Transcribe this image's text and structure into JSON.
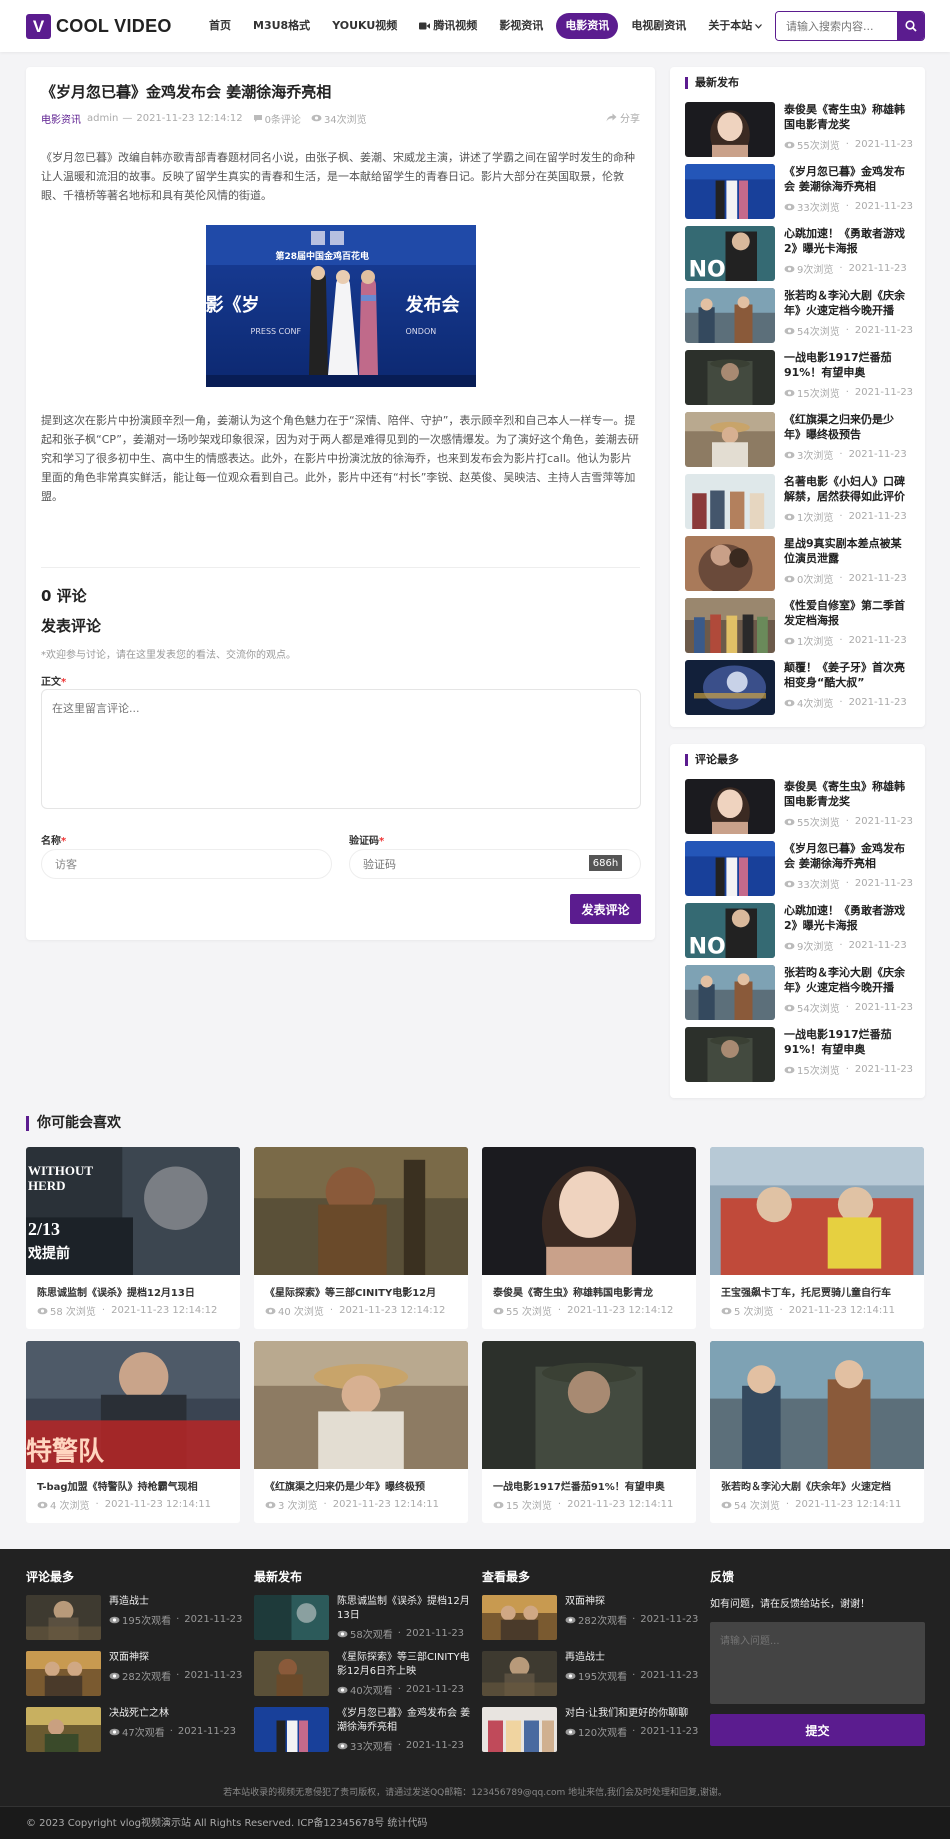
{
  "header": {
    "logo_letter": "V",
    "logo_text": "COOL VIDEO",
    "nav": [
      {
        "label": "首页",
        "active": false
      },
      {
        "label": "M3U8格式",
        "active": false
      },
      {
        "label": "YOUKU视频",
        "active": false
      },
      {
        "label": "腾讯视频",
        "active": false,
        "icon": "video-camera-icon"
      },
      {
        "label": "影视资讯",
        "active": false
      },
      {
        "label": "电影资讯",
        "active": true
      },
      {
        "label": "电视剧资讯",
        "active": false
      },
      {
        "label": "关于本站",
        "active": false,
        "dropdown": true
      }
    ],
    "search_placeholder": "请输入搜索内容..."
  },
  "article": {
    "title": "《岁月忽已暮》金鸡发布会 姜潮徐海乔亮相",
    "category": "电影资讯",
    "author": "admin",
    "dash": "—",
    "date": "2021-11-23 12:14:12",
    "comments": "0条评论",
    "views": "34次浏览",
    "share": "分享",
    "para1": "《岁月忽已暮》改编自韩亦歌青部青春题材同名小说，由张子枫、姜潮、宋威龙主演，讲述了学霸之间在留学时发生的命种让人温暖和流泪的故事。反映了留学生真实的青春和生活，是一本献给留学生的青春日记。影片大部分在英国取景，伦敦眼、千禧桥等著名地标和具有英伦风情的街道。",
    "para2": "提到这次在影片中扮演顾辛烈一角，姜潮认为这个角色魅力在于“深情、陪伴、守护”，表示顾辛烈和自己本人一样专一。提起和张子枫“CP”，姜潮对一场吵架戏印象很深，因为对于两人都是难得见到的一次感情爆发。为了演好这个角色，姜潮去研究和学习了很多初中生、高中生的情感表达。此外，在影片中扮演沈放的徐海乔，也来到发布会为影片打call。他认为影片里面的角色非常真实鲜活，能让每一位观众看到自己。此外，影片中还有“村长”李锐、赵英俊、吴映洁、主持人吉雪萍等加盟。",
    "image_text_big": "影《岁",
    "image_text_right": "发布会",
    "image_text_top": "第28届中国金鸡百花电",
    "image_text_press": "PRESS CONF",
    "image_text_london": "ONDON"
  },
  "comments": {
    "count_title": "0 评论",
    "form_title": "发表评论",
    "note": "*欢迎参与讨论，请在这里发表您的看法、交流你的观点。",
    "body_label": "正文",
    "body_placeholder": "在这里留言评论...",
    "name_label": "名称",
    "name_value": "访客",
    "captcha_label": "验证码",
    "captcha_placeholder": "验证码",
    "captcha_code": "686h",
    "submit_label": "发表评论",
    "required_mark": "*"
  },
  "sidebar_latest": {
    "title": "最新发布",
    "items": [
      {
        "title": "泰俊昊《寄生虫》称雄韩国电影青龙奖",
        "views": "55次浏览",
        "date": "2021-11-23",
        "thumb": "t-actress"
      },
      {
        "title": "《岁月忽已暮》金鸡发布会 姜潮徐海乔亮相",
        "views": "33次浏览",
        "date": "2021-11-23",
        "thumb": "t-press"
      },
      {
        "title": "心跳加速！《勇敢者游戏2》曝光卡海报",
        "views": "9次浏览",
        "date": "2021-11-23",
        "thumb": "t-bond"
      },
      {
        "title": "张若昀＆李沁大剧《庆余年》火速定档今晚开播",
        "views": "54次浏览",
        "date": "2021-11-23",
        "thumb": "t-drama"
      },
      {
        "title": "一战电影1917烂番茄91%！有望申奥",
        "views": "15次浏览",
        "date": "2021-11-23",
        "thumb": "t-war"
      },
      {
        "title": "《红旗渠之归来仍是少年》曝终极预告",
        "views": "3次浏览",
        "date": "2021-11-23",
        "thumb": "t-village"
      },
      {
        "title": "名著电影《小妇人》口碑解禁，居然获得如此评价",
        "views": "1次浏览",
        "date": "2021-11-23",
        "thumb": "t-women"
      },
      {
        "title": "星战9真实剧本差点被某位演员泄露",
        "views": "0次浏览",
        "date": "2021-11-23",
        "thumb": "t-hug"
      },
      {
        "title": "《性爱自修室》第二季首发定档海报",
        "views": "1次浏览",
        "date": "2021-11-23",
        "thumb": "t-group"
      },
      {
        "title": "颠覆！《姜子牙》首次亮相变身“酷大叔”",
        "views": "4次浏览",
        "date": "2021-11-23",
        "thumb": "t-anim"
      }
    ]
  },
  "sidebar_top": {
    "title": "评论最多",
    "items": [
      {
        "title": "泰俊昊《寄生虫》称雄韩国电影青龙奖",
        "views": "55次浏览",
        "date": "2021-11-23",
        "thumb": "t-actress"
      },
      {
        "title": "《岁月忽已暮》金鸡发布会 姜潮徐海乔亮相",
        "views": "33次浏览",
        "date": "2021-11-23",
        "thumb": "t-press"
      },
      {
        "title": "心跳加速！《勇敢者游戏2》曝光卡海报",
        "views": "9次浏览",
        "date": "2021-11-23",
        "thumb": "t-bond"
      },
      {
        "title": "张若昀＆李沁大剧《庆余年》火速定档今晚开播",
        "views": "54次浏览",
        "date": "2021-11-23",
        "thumb": "t-drama"
      },
      {
        "title": "一战电影1917烂番茄91%！有望申奥",
        "views": "15次浏览",
        "date": "2021-11-23",
        "thumb": "t-war"
      }
    ]
  },
  "may_like": {
    "title": "你可能会喜欢",
    "items": [
      {
        "title": "陈思诚监制《误杀》提档12月13日",
        "views": "58 次浏览",
        "date": "2021-11-23 12:14:12",
        "thumb": "t-poster"
      },
      {
        "title": "《星际探索》等三部CINITY电影12月",
        "views": "40 次浏览",
        "date": "2021-11-23 12:14:12",
        "thumb": "t-jungle"
      },
      {
        "title": "泰俊昊《寄生虫》称雄韩国电影青龙",
        "views": "55 次浏览",
        "date": "2021-11-23 12:14:12",
        "thumb": "t-actress"
      },
      {
        "title": "王宝强飙卡丁车，托尼贾骑儿童自行车",
        "views": "5 次浏览",
        "date": "2021-11-23 12:14:11",
        "thumb": "t-crowd"
      },
      {
        "title": "T-bag加盟《特警队》持枪霸气现相",
        "views": "4 次浏览",
        "date": "2021-11-23 12:14:11",
        "thumb": "t-tbag"
      },
      {
        "title": "《红旗渠之归来仍是少年》曝终极预",
        "views": "3 次浏览",
        "date": "2021-11-23 12:14:11",
        "thumb": "t-village"
      },
      {
        "title": "一战电影1917烂番茄91%！有望申奥",
        "views": "15 次浏览",
        "date": "2021-11-23 12:14:11",
        "thumb": "t-war"
      },
      {
        "title": "张若昀＆李沁大剧《庆余年》火速定档",
        "views": "54 次浏览",
        "date": "2021-11-23 12:14:11",
        "thumb": "t-drama"
      }
    ],
    "poster_text": "WITHOUT HERD",
    "poster_date": "2/13",
    "poster_cn": "戏提前",
    "tbag_text": "特警队"
  },
  "footer": {
    "col1": {
      "title": "评论最多",
      "items": [
        {
          "title": "再造战士",
          "views": "195次观看",
          "date": "2021-11-23",
          "thumb": "f-soldier"
        },
        {
          "title": "双面神探",
          "views": "282次观看",
          "date": "2021-11-23",
          "thumb": "f-detective"
        },
        {
          "title": "决战死亡之林",
          "views": "47次观看",
          "date": "2021-11-23",
          "thumb": "f-forest"
        }
      ]
    },
    "col2": {
      "title": "最新发布",
      "items": [
        {
          "title": "陈思诚监制《误杀》提档12月13日",
          "views": "58次观看",
          "date": "2021-11-23",
          "thumb": "f-poster"
        },
        {
          "title": "《星际探索》等三部CINITY电影12月6日齐上映",
          "views": "40次观看",
          "date": "2021-11-23",
          "thumb": "f-jungle"
        },
        {
          "title": "《岁月忽已暮》金鸡发布会 姜潮徐海乔亮相",
          "views": "33次观看",
          "date": "2021-11-23",
          "thumb": "f-press"
        }
      ]
    },
    "col3": {
      "title": "查看最多",
      "items": [
        {
          "title": "双面神探",
          "views": "282次观看",
          "date": "2021-11-23",
          "thumb": "f-detective"
        },
        {
          "title": "再造战士",
          "views": "195次观看",
          "date": "2021-11-23",
          "thumb": "f-soldier"
        },
        {
          "title": "对白·让我们和更好的你聊聊",
          "views": "120次观看",
          "date": "2021-11-23",
          "thumb": "f-talk"
        }
      ]
    },
    "feedback": {
      "title": "反馈",
      "note": "如有问题，请在反馈给站长，谢谢！",
      "placeholder": "请输入问题...",
      "submit": "提交"
    },
    "notice": "若本站收录的视频无意侵犯了贵司版权，请通过发送QQ邮箱：123456789@qq.com 地址来信,我们会及时处理和回复,谢谢。",
    "copyright": "© 2023 Copyright vlog视频演示站 All Rights Reserved. ICP备12345678号 统计代码"
  },
  "colors": {
    "accent": "#5b1c8f",
    "footer_bg": "#222222"
  }
}
